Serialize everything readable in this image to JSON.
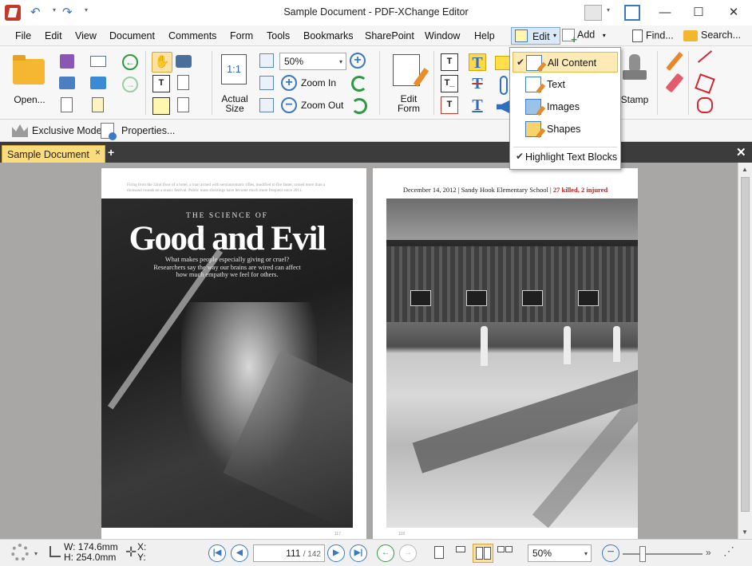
{
  "window": {
    "title": "Sample Document - PDF-XChange Editor",
    "minimize_icon": "—",
    "maximize_icon": "☐",
    "close_icon": "✕"
  },
  "quick_access": {
    "undo_icon": "↶",
    "redo_icon": "↷",
    "dropdown_icon": "▾"
  },
  "menu": {
    "items": [
      "File",
      "Edit",
      "View",
      "Document",
      "Comments",
      "Form",
      "Tools",
      "Bookmarks",
      "SharePoint",
      "Window",
      "Help"
    ],
    "edit_label": "Edit",
    "add_label": "Add",
    "find_label": "Find...",
    "search_label": "Search...",
    "arrow": "▾"
  },
  "toolbar": {
    "open_label": "Open...",
    "actual_size_label": "Actual\nSize",
    "actual_size_glyph": "1:1",
    "zoom_value": "50%",
    "zoom_in_label": "Zoom In",
    "zoom_out_label": "Zoom Out",
    "edit_form_label": "Edit\nForm",
    "stamp_label": "Stamp",
    "hand_glyph": "✋",
    "plus_glyph": "+",
    "minus_glyph": "−",
    "back_glyph": "←",
    "forward_glyph": "→",
    "t_glyph": "T",
    "tbox_glyph": "T_"
  },
  "subbar": {
    "exclusive_mode_label": "Exclusive Mode",
    "properties_label": "Properties..."
  },
  "tabs": {
    "document_tab": "Sample Document",
    "tab_close": "×",
    "tab_add": "+",
    "close_all": "✕"
  },
  "document": {
    "left_page": {
      "caption": "Firing from the 32nd floor of a hotel, a man armed with semiautomatic rifles, modified to fire faster, rained more than a thousand rounds on a music festival. Public mass shootings have become much more frequent since 2011.",
      "kicker": "THE SCIENCE OF",
      "title": "Good and Evil",
      "subtitle": "What makes people especially giving or cruel? Researchers say the way our brains are wired can affect how much empathy we feel for others.",
      "page_number": "117"
    },
    "right_page": {
      "header_date": "December 14, 2012",
      "header_sep": "|",
      "header_place": "Sandy Hook Elementary School",
      "header_casualties": "27 killed, 2 injured",
      "page_number": "118"
    }
  },
  "edit_dropdown": {
    "items": [
      {
        "label": "All Content",
        "checked": true,
        "active": true
      },
      {
        "label": "Text",
        "checked": false
      },
      {
        "label": "Images",
        "checked": false
      },
      {
        "label": "Shapes",
        "checked": false
      }
    ],
    "toggle_label": "Highlight Text Blocks",
    "toggle_checked": true,
    "check_glyph": "✔"
  },
  "statusbar": {
    "width_label": "W: 174.6mm",
    "height_label": "H: 254.0mm",
    "x_label": "X:",
    "y_label": "Y:",
    "current_page": "111",
    "total_pages": "/ 142",
    "zoom_value": "50%",
    "first_glyph": "|◀",
    "prev_glyph": "◀",
    "next_glyph": "▶",
    "last_glyph": "▶|",
    "back_glyph": "←",
    "forward_glyph": "→",
    "more_glyph": "»",
    "crosshair_glyph": "✛",
    "grip_glyph": "⋰",
    "zoom_minus_glyph": "−"
  },
  "colors": {
    "accent": "#3a78c2",
    "active_tab": "#fbdc7c",
    "menu_highlight": "#fdeab4",
    "viewport_bg": "#a8a7a5",
    "casualty_red": "#c02020"
  }
}
